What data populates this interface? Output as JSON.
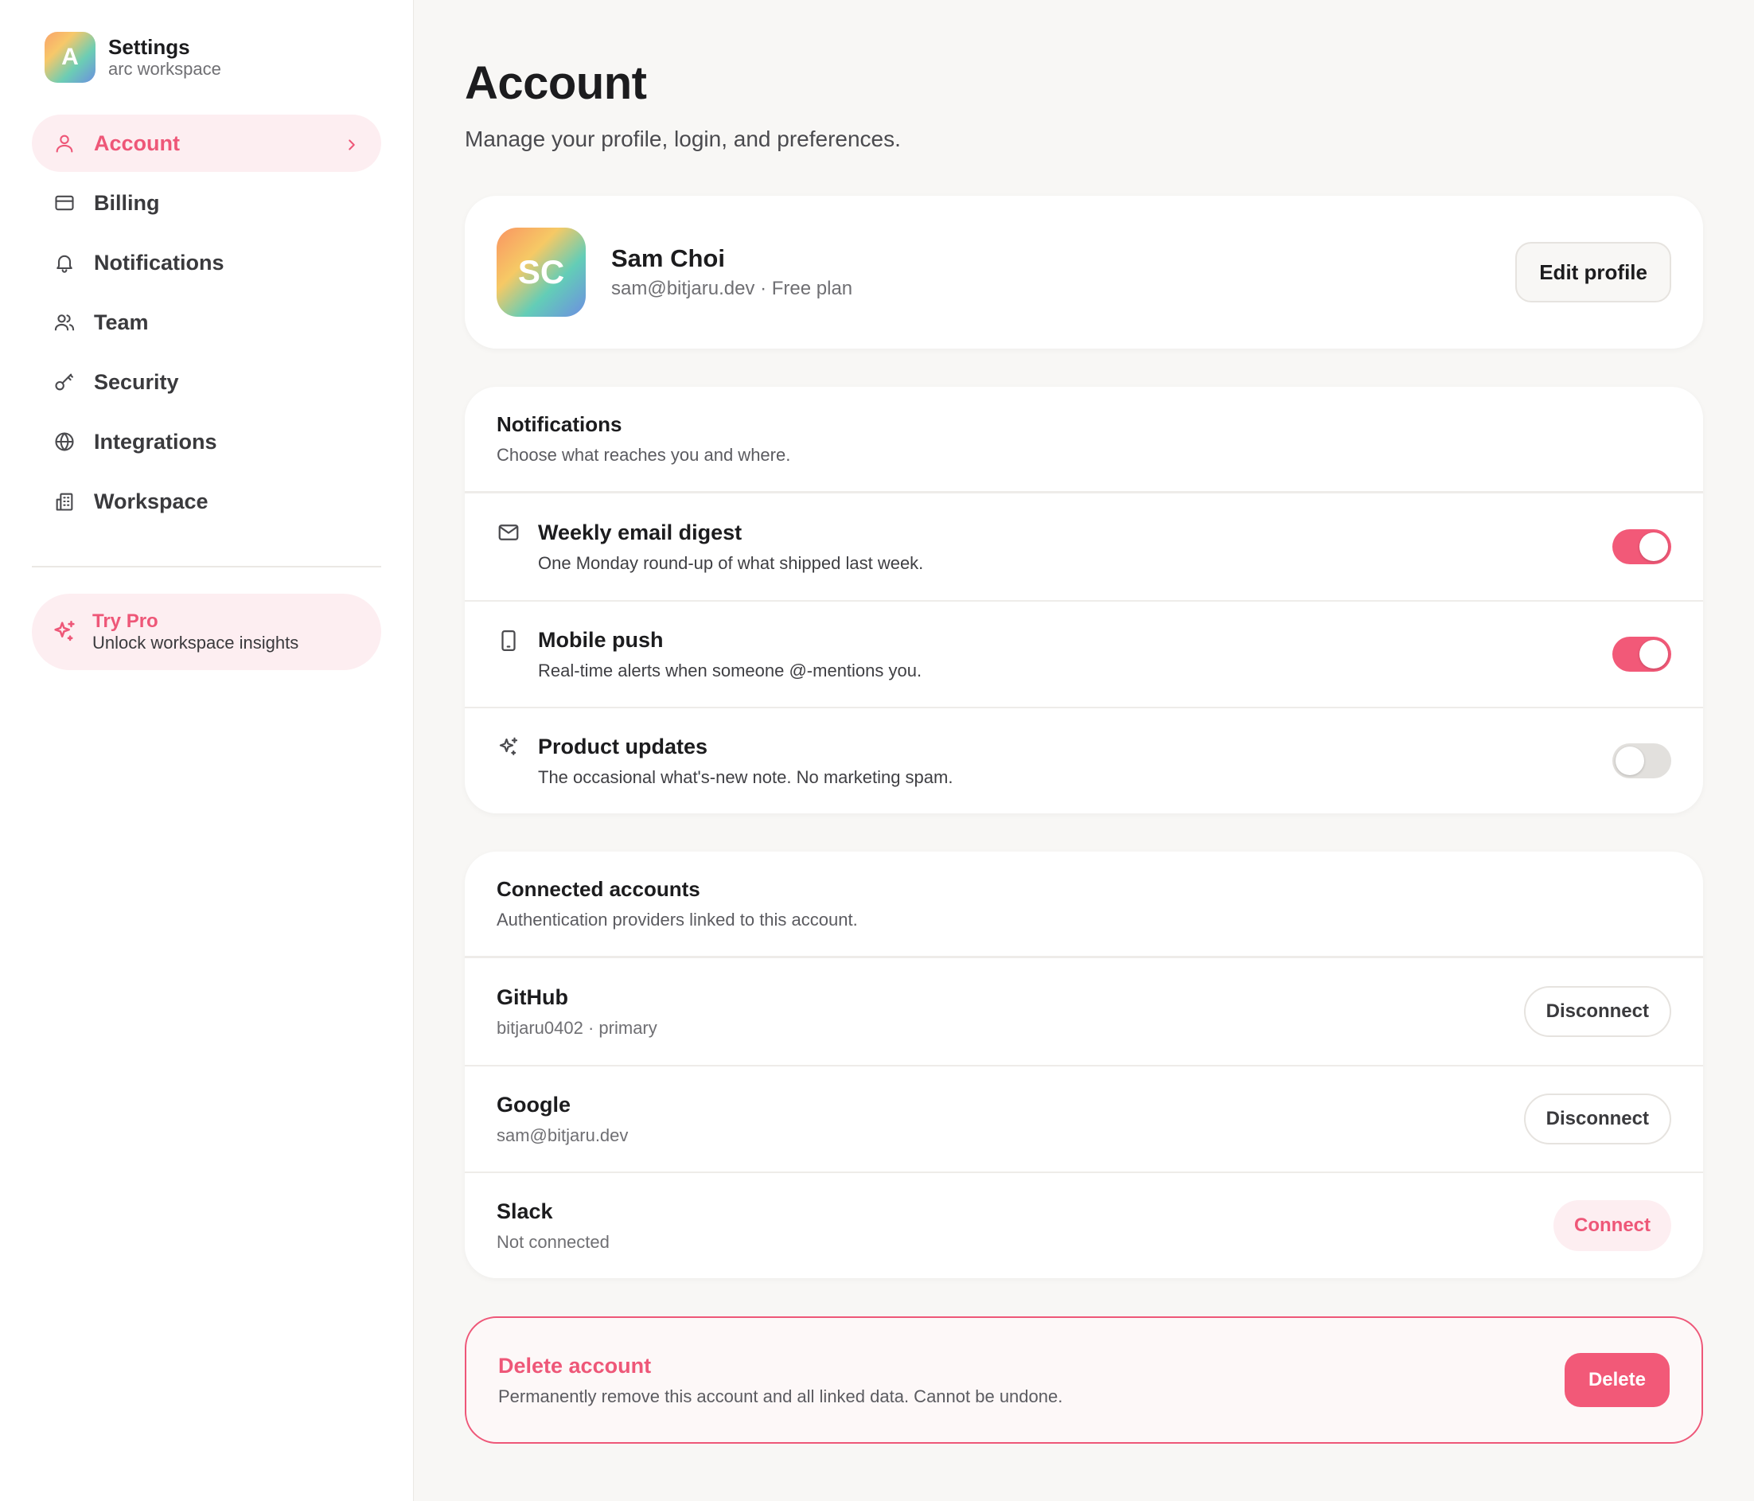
{
  "sidebar": {
    "brand": {
      "logo_letter": "A",
      "title": "Settings",
      "subtitle": "arc workspace"
    },
    "items": [
      {
        "label": "Account",
        "icon": "user-icon",
        "active": true
      },
      {
        "label": "Billing",
        "icon": "credit-card-icon"
      },
      {
        "label": "Notifications",
        "icon": "bell-icon"
      },
      {
        "label": "Team",
        "icon": "users-icon"
      },
      {
        "label": "Security",
        "icon": "key-icon"
      },
      {
        "label": "Integrations",
        "icon": "globe-icon"
      },
      {
        "label": "Workspace",
        "icon": "building-icon"
      }
    ],
    "promo": {
      "title": "Try Pro",
      "subtitle": "Unlock workspace insights",
      "icon": "sparkles-icon"
    }
  },
  "main": {
    "title": "Account",
    "subtitle": "Manage your profile, login, and preferences.",
    "profile": {
      "initials": "SC",
      "name": "Sam Choi",
      "meta": "sam@bitjaru.dev · Free plan",
      "edit_label": "Edit profile"
    },
    "notifications": {
      "title": "Notifications",
      "desc": "Choose what reaches you and where.",
      "rows": [
        {
          "title": "Weekly email digest",
          "desc": "One Monday round-up of what shipped last week.",
          "icon": "mail-icon",
          "enabled": true
        },
        {
          "title": "Mobile push",
          "desc": "Real-time alerts when someone @-mentions you.",
          "icon": "phone-icon",
          "enabled": true
        },
        {
          "title": "Product updates",
          "desc": "The occasional what's-new note. No marketing spam.",
          "icon": "sparkles-icon",
          "enabled": false
        }
      ]
    },
    "connected": {
      "title": "Connected accounts",
      "desc": "Authentication providers linked to this account.",
      "rows": [
        {
          "title": "GitHub",
          "desc": "bitjaru0402 · primary",
          "action": "Disconnect"
        },
        {
          "title": "Google",
          "desc": "sam@bitjaru.dev",
          "action": "Disconnect"
        },
        {
          "title": "Slack",
          "desc": "Not connected",
          "action": "Connect"
        }
      ]
    },
    "danger": {
      "title": "Delete account",
      "desc": "Permanently remove this account and all linked data. Cannot be undone.",
      "button": "Delete"
    }
  },
  "colors": {
    "accent": "#ee5778",
    "accent_soft": "#fdeef1",
    "background": "#f8f7f5"
  }
}
